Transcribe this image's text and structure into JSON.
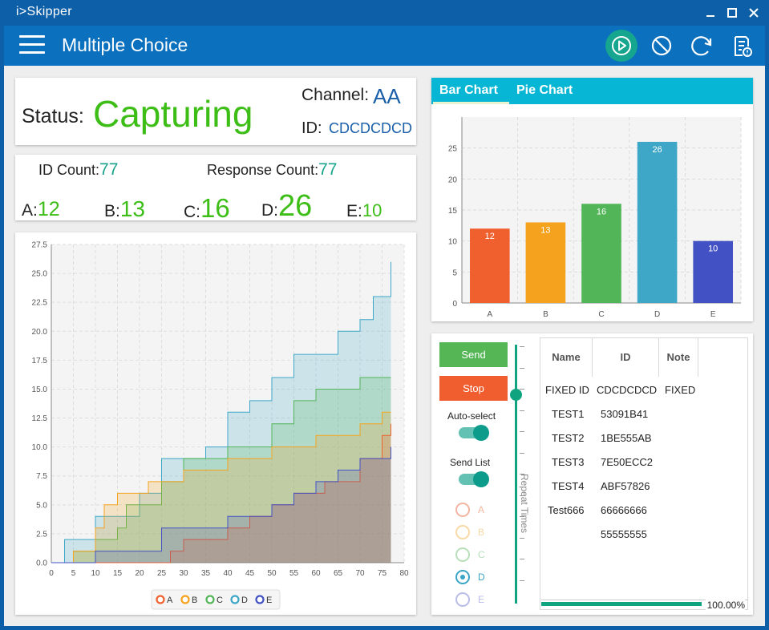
{
  "window": {
    "title": "i>Skipper"
  },
  "header": {
    "title": "Multiple Choice"
  },
  "status": {
    "label": "Status:",
    "value": "Capturing",
    "channel_label": "Channel:",
    "channel_value": "AA",
    "id_label": "ID:",
    "id_value": "CDCDCDCD"
  },
  "counts": {
    "id_count_label": "ID Count:",
    "id_count": "77",
    "response_count_label": "Response Count:",
    "response_count": "77",
    "letters": [
      {
        "label": "A:",
        "value": "12"
      },
      {
        "label": "B:",
        "value": "13"
      },
      {
        "label": "C:",
        "value": "16"
      },
      {
        "label": "D:",
        "value": "26"
      },
      {
        "label": "E:",
        "value": "10"
      }
    ]
  },
  "tabs": [
    {
      "label": "Bar Chart",
      "active": true
    },
    {
      "label": "Pie Chart",
      "active": false
    }
  ],
  "controls": {
    "send_label": "Send",
    "stop_label": "Stop",
    "auto_select_label": "Auto-select",
    "auto_select_on": true,
    "send_list_label": "Send List",
    "send_list_on": true,
    "repeat_label": "Repeat Times",
    "options": [
      {
        "label": "A",
        "color": "#f2b6a0",
        "selected": false
      },
      {
        "label": "B",
        "color": "#f8d9a5",
        "selected": false
      },
      {
        "label": "C",
        "color": "#b7e0b9",
        "selected": false
      },
      {
        "label": "D",
        "color": "#3aa5c8",
        "selected": true
      },
      {
        "label": "E",
        "color": "#b9bde8",
        "selected": false
      }
    ]
  },
  "table": {
    "columns": [
      "Name",
      "ID",
      "Note"
    ],
    "rows": [
      [
        "FIXED ID",
        "CDCDCDCD",
        "FIXED"
      ],
      [
        "TEST1",
        "53091B41",
        ""
      ],
      [
        "TEST2",
        "1BE555AB",
        ""
      ],
      [
        "TEST3",
        "7E50ECC2",
        ""
      ],
      [
        "TEST4",
        "ABF57826",
        ""
      ],
      [
        "Test666",
        "66666666",
        ""
      ],
      [
        "",
        "55555555",
        ""
      ]
    ],
    "progress": 1.0,
    "progress_label": "100.00%"
  },
  "colors": {
    "A": "#f0602f",
    "B": "#f5a31e",
    "C": "#52b557",
    "D": "#3ea7c8",
    "E": "#4252c4",
    "accent": "#0d9c8b",
    "title_bar": "#0d5fa7",
    "header": "#0b70bd"
  },
  "chart_data": [
    {
      "type": "bar",
      "categories": [
        "A",
        "B",
        "C",
        "D",
        "E"
      ],
      "values": [
        12,
        13,
        16,
        26,
        10
      ],
      "ylim": [
        0,
        30
      ],
      "yticks": [
        0,
        5,
        10,
        15,
        20,
        25
      ],
      "grid": true,
      "title": "",
      "xlabel": "",
      "ylabel": ""
    },
    {
      "type": "area",
      "xlim": [
        0,
        80
      ],
      "ylim": [
        0,
        27.5
      ],
      "xticks": [
        0,
        5,
        10,
        15,
        20,
        25,
        30,
        35,
        40,
        45,
        50,
        55,
        60,
        65,
        70,
        75,
        80
      ],
      "yticks": [
        "0.0",
        "2.5",
        "5.0",
        "7.5",
        "10.0",
        "12.5",
        "15.0",
        "17.5",
        "20.0",
        "22.5",
        "25.0",
        "27.5"
      ],
      "grid": true,
      "legend_position": "bottom-center",
      "series": [
        {
          "name": "A",
          "x": [
            0,
            27,
            30,
            40,
            45,
            50,
            55,
            62,
            70,
            75,
            77
          ],
          "y": [
            0,
            1,
            2,
            3,
            4,
            5,
            6,
            7,
            9,
            11,
            12
          ]
        },
        {
          "name": "B",
          "x": [
            0,
            5,
            10,
            12,
            15,
            18,
            22,
            30,
            40,
            50,
            60,
            65,
            70,
            75,
            77
          ],
          "y": [
            0,
            1,
            3,
            5,
            6,
            6,
            7,
            8,
            9,
            10,
            11,
            11,
            12,
            13,
            13
          ]
        },
        {
          "name": "C",
          "x": [
            0,
            5,
            10,
            15,
            17,
            20,
            25,
            30,
            40,
            50,
            55,
            60,
            70,
            77
          ],
          "y": [
            0,
            1,
            2,
            3,
            5,
            5,
            7,
            9,
            10,
            12,
            14,
            15,
            16,
            16
          ]
        },
        {
          "name": "D",
          "x": [
            0,
            3,
            5,
            10,
            15,
            20,
            25,
            30,
            35,
            40,
            45,
            50,
            55,
            60,
            65,
            70,
            73,
            77
          ],
          "y": [
            0,
            2,
            2,
            4,
            4,
            6,
            9,
            9,
            10,
            13,
            14,
            16,
            18,
            18,
            20,
            21,
            23,
            26
          ]
        },
        {
          "name": "E",
          "x": [
            0,
            10,
            20,
            25,
            35,
            40,
            50,
            55,
            60,
            65,
            70,
            77
          ],
          "y": [
            0,
            1,
            1,
            3,
            3,
            4,
            5,
            6,
            7,
            8,
            9,
            10
          ]
        }
      ]
    }
  ]
}
